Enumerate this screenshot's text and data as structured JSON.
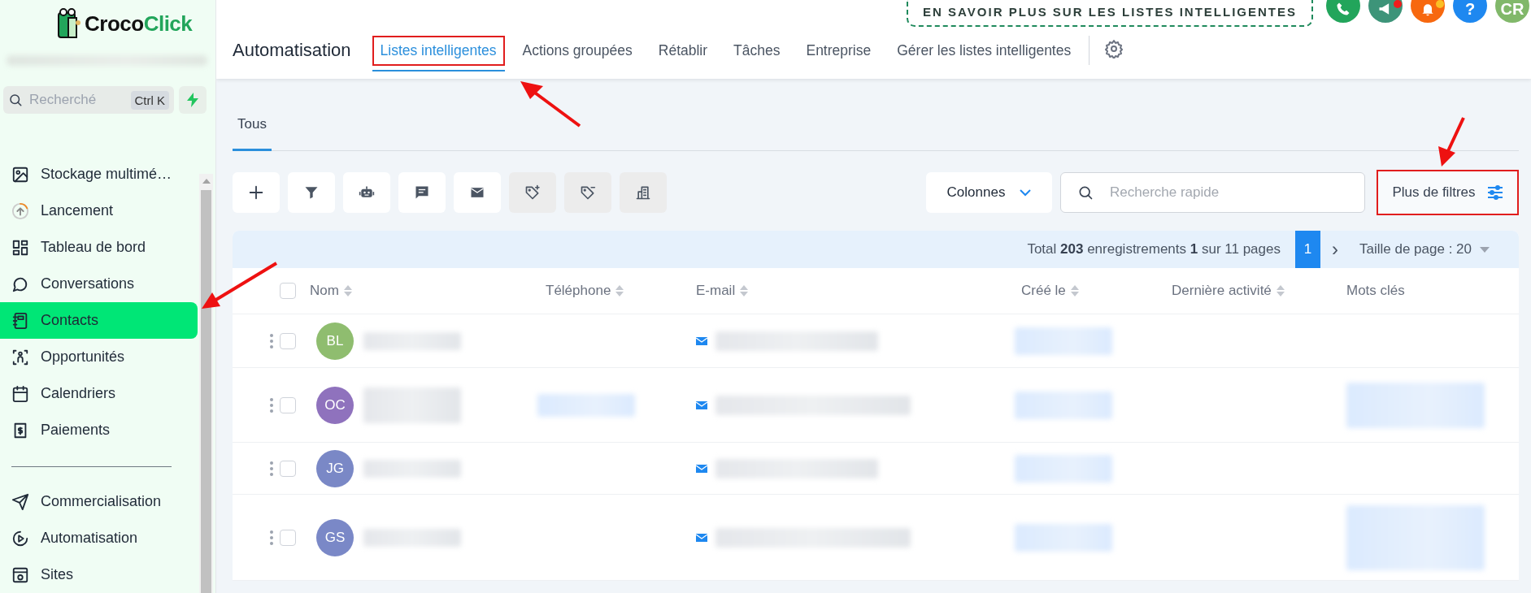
{
  "sidebar": {
    "logo": {
      "text_dark": "Croco",
      "text_accent": "Click"
    },
    "search": {
      "placeholder": "Recherché",
      "shortcut": "Ctrl K"
    },
    "sections": [
      {
        "items": [
          {
            "label": "Stockage multimé…",
            "selected": false
          },
          {
            "label": "Lancement",
            "selected": false
          },
          {
            "label": "Tableau de bord",
            "selected": false
          },
          {
            "label": "Conversations",
            "selected": false
          },
          {
            "label": "Contacts",
            "selected": true
          },
          {
            "label": "Opportunités",
            "selected": false
          },
          {
            "label": "Calendriers",
            "selected": false
          },
          {
            "label": "Paiements",
            "selected": false
          }
        ]
      },
      {
        "items": [
          {
            "label": "Commercialisation",
            "selected": false
          },
          {
            "label": "Automatisation",
            "selected": false
          },
          {
            "label": "Sites",
            "selected": false
          }
        ]
      }
    ]
  },
  "header": {
    "banner": "EN SAVOIR PLUS SUR LES LISTES INTELLIGENTES",
    "icons": [
      {
        "kind": "phone",
        "notification_dot": false
      },
      {
        "kind": "megaphone",
        "notification_dot": true
      },
      {
        "kind": "bell",
        "notification_dot": true
      },
      {
        "kind": "help",
        "label": "?",
        "notification_dot": false
      },
      {
        "kind": "avatar",
        "label": "CR",
        "notification_dot": false
      }
    ],
    "title": "Automatisation",
    "tabs": [
      {
        "label": "Listes intelligentes",
        "selected": true,
        "highlighted": true
      },
      {
        "label": "Actions groupées",
        "selected": false,
        "highlighted": false
      },
      {
        "label": "Rétablir",
        "selected": false,
        "highlighted": false
      },
      {
        "label": "Tâches",
        "selected": false,
        "highlighted": false
      },
      {
        "label": "Entreprise",
        "selected": false,
        "highlighted": false
      },
      {
        "label": "Gérer les listes intelligentes",
        "selected": false,
        "highlighted": false
      }
    ]
  },
  "subtabs": [
    {
      "label": "Tous",
      "selected": true
    }
  ],
  "toolbar": {
    "buttons": [
      {
        "disabled": false
      },
      {
        "disabled": false
      },
      {
        "disabled": false
      },
      {
        "disabled": false
      },
      {
        "disabled": false
      },
      {
        "disabled": true
      },
      {
        "disabled": true
      },
      {
        "disabled": true
      }
    ],
    "columns_button": "Colonnes",
    "search": {
      "placeholder": "Recherche rapide"
    },
    "more_filters": {
      "label": "Plus de filtres",
      "highlighted": true
    }
  },
  "pagination": {
    "summary": "Total **203** enregistrements **1** sur 11 pages",
    "pages": [
      {
        "label": "1",
        "selected": true
      }
    ],
    "next": "›",
    "page_size": "Taille de page : 20"
  },
  "table": {
    "select_all_checked": false,
    "columns": [
      {
        "label": "Nom",
        "sortable": true
      },
      {
        "label": "Téléphone",
        "sortable": true
      },
      {
        "label": "E-mail",
        "sortable": true
      },
      {
        "label": "Créé le",
        "sortable": true
      },
      {
        "label": "Dernière activité",
        "sortable": true
      },
      {
        "label": "Mots clés",
        "sortable": false
      }
    ],
    "rows": [
      {
        "initials": "BL",
        "color": "#8fbd6f",
        "checked": false,
        "phone_redacted": false,
        "tags_redacted": false
      },
      {
        "initials": "OC",
        "color": "#8f72bd",
        "checked": false,
        "phone_redacted": true,
        "tags_redacted": true
      },
      {
        "initials": "JG",
        "color": "#7a88c6",
        "checked": false,
        "phone_redacted": false,
        "tags_redacted": false
      },
      {
        "initials": "GS",
        "color": "#7a88c7",
        "checked": false,
        "phone_redacted": false,
        "tags_redacted": true
      }
    ]
  }
}
